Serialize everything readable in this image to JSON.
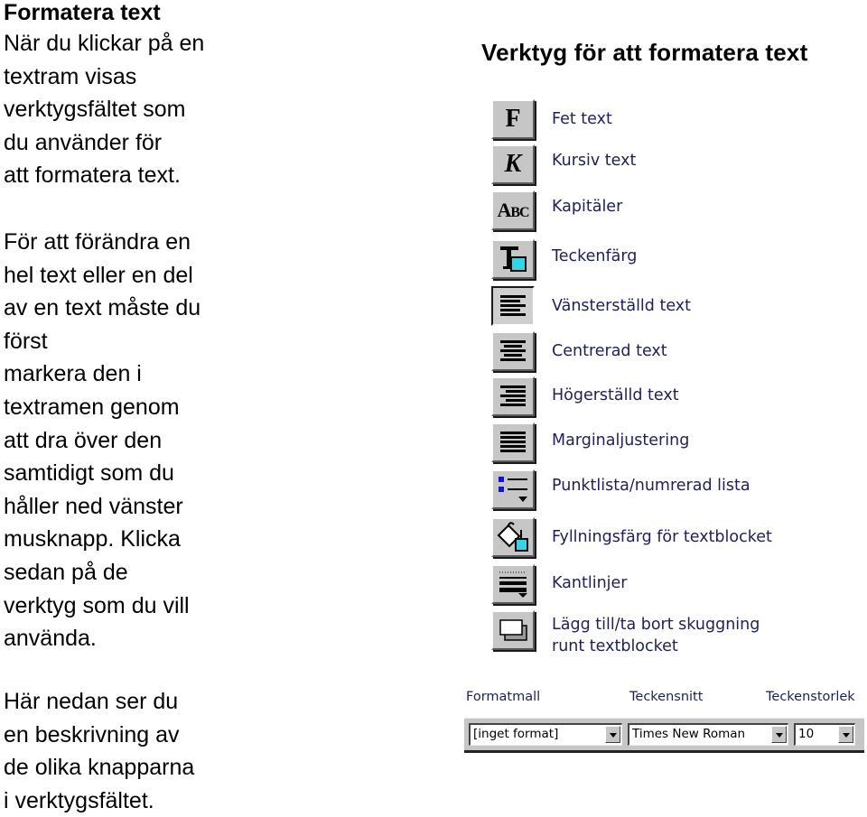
{
  "left": {
    "title": "Formatera text",
    "para1": [
      "När du klickar på en",
      "textram visas",
      "verktygsfältet som",
      "du använder för",
      "att formatera text."
    ],
    "para2": [
      "För att förändra en",
      "hel text eller en del",
      "av en text måste du",
      "först",
      "markera den i",
      "textramen genom",
      "att dra över den",
      "samtidigt som du",
      "håller ned vänster",
      "musknapp. Klicka",
      "sedan på de",
      "verktyg som du vill",
      "använda."
    ],
    "para3": [
      "Här nedan ser du",
      "en beskrivning av",
      "de olika knapparna",
      "i verktygsfältet."
    ]
  },
  "right": {
    "title": "Verktyg för att formatera text",
    "tools": [
      {
        "icon": "bold-icon",
        "glyph": "F",
        "label": "Fet text"
      },
      {
        "icon": "italic-icon",
        "glyph": "K",
        "label": "Kursiv text"
      },
      {
        "icon": "small-caps-icon",
        "glyph": "ABC",
        "label": "Kapitäler"
      },
      {
        "icon": "font-color-icon",
        "label": "Teckenfärg"
      },
      {
        "icon": "align-left-icon",
        "label": "Vänsterställd text",
        "pressed": true
      },
      {
        "icon": "align-center-icon",
        "label": "Centrerad text"
      },
      {
        "icon": "align-right-icon",
        "label": "Högerställd text"
      },
      {
        "icon": "justify-icon",
        "label": "Marginaljustering"
      },
      {
        "icon": "bullet-list-icon",
        "label": "Punktlista/numrerad lista"
      },
      {
        "icon": "fill-color-icon",
        "label": "Fyllningsfärg för textblocket"
      },
      {
        "icon": "borders-icon",
        "label": "Kantlinjer"
      },
      {
        "icon": "shadow-icon",
        "label_lines": [
          "Lägg till/ta bort skuggning",
          "runt textblocket"
        ]
      }
    ],
    "format_bar": {
      "style_label": "Formatmall",
      "font_label": "Teckensnitt",
      "size_label": "Teckenstorlek",
      "style_value": "[inget format]",
      "font_value": "Times New Roman",
      "size_value": "10"
    },
    "colors": {
      "label": "#1f1f5a",
      "button_face": "#c6c6c6",
      "accent_cyan": "#33d6e6",
      "bullet_blue": "#1010e0"
    }
  }
}
